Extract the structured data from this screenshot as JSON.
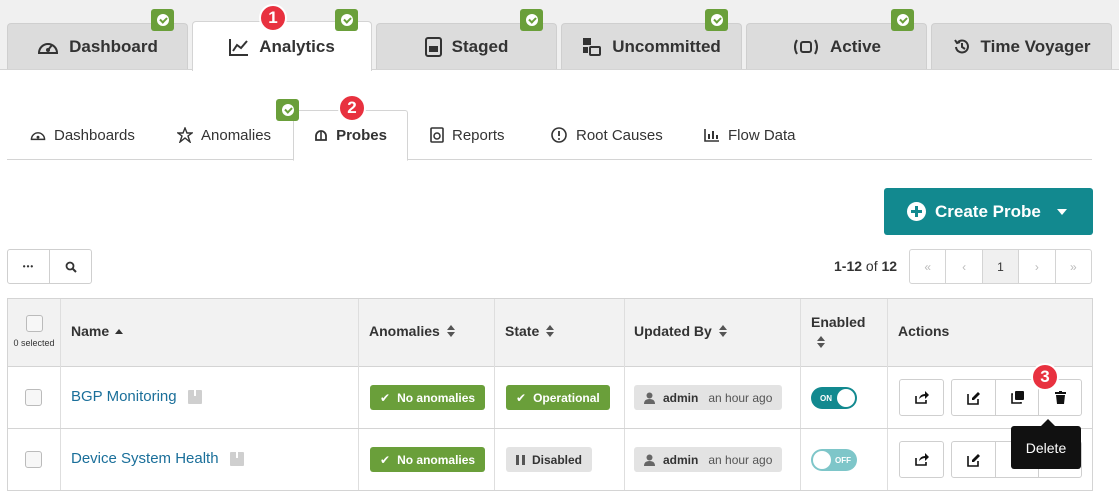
{
  "top_tabs": [
    {
      "label": "Dashboard",
      "icon": "gauge-icon"
    },
    {
      "label": "Analytics",
      "icon": "line-chart-icon",
      "active": true
    },
    {
      "label": "Staged",
      "icon": "document-icon"
    },
    {
      "label": "Uncommitted",
      "icon": "uncommitted-icon"
    },
    {
      "label": "Active",
      "icon": "broadcast-icon"
    },
    {
      "label": "Time Voyager",
      "icon": "history-icon"
    }
  ],
  "callouts": {
    "one": "1",
    "two": "2",
    "three": "3"
  },
  "sub_tabs": [
    {
      "label": "Dashboards",
      "icon": "gauge-icon"
    },
    {
      "label": "Anomalies",
      "icon": "anomaly-icon"
    },
    {
      "label": "Probes",
      "icon": "probe-icon",
      "active": true
    },
    {
      "label": "Reports",
      "icon": "report-icon"
    },
    {
      "label": "Root Causes",
      "icon": "root-cause-icon"
    },
    {
      "label": "Flow Data",
      "icon": "bar-chart-icon"
    }
  ],
  "create_button": {
    "label": "Create Probe"
  },
  "toolbar": {
    "more_label": "•••"
  },
  "paging": {
    "range": "1-12",
    "of_text": "of",
    "total": "12",
    "current_page": "1",
    "first": "«",
    "prev": "‹",
    "next": "›",
    "last": "»"
  },
  "table": {
    "selected_text": "0 selected",
    "headers": {
      "name": "Name",
      "anomalies": "Anomalies",
      "state": "State",
      "updated_by": "Updated By",
      "enabled": "Enabled",
      "actions": "Actions"
    },
    "rows": [
      {
        "name": "BGP Monitoring",
        "anomalies": "No anomalies",
        "state": "Operational",
        "user": "admin",
        "time": "an hour ago",
        "enabled": "ON"
      },
      {
        "name": "Device System Health",
        "anomalies": "No anomalies",
        "state": "Disabled",
        "user": "admin",
        "time": "an hour ago",
        "enabled": "OFF"
      }
    ]
  },
  "tooltip": {
    "label": "Delete"
  },
  "colors": {
    "accent": "#12898f",
    "success": "#6a9f3a",
    "callout": "#e8313f",
    "link": "#1a6f9a"
  }
}
